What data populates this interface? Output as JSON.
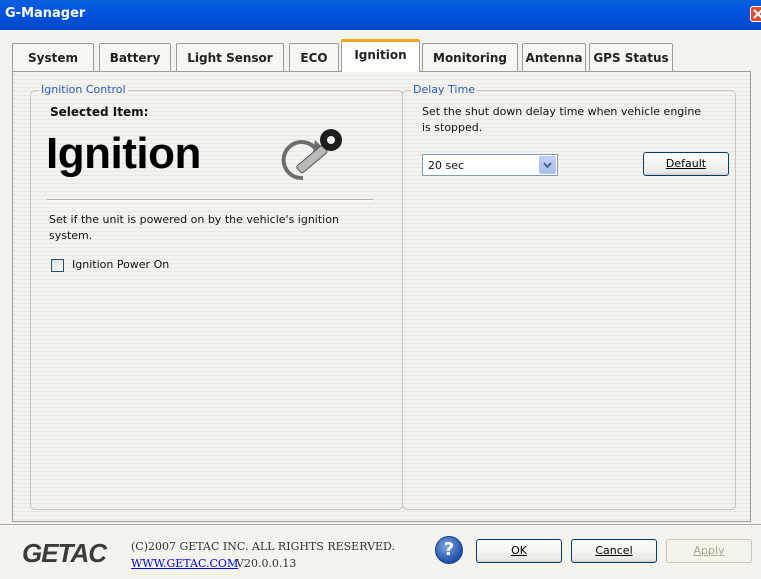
{
  "window": {
    "title": "G-Manager"
  },
  "tabs": [
    {
      "label": "System"
    },
    {
      "label": "Battery"
    },
    {
      "label": "Light Sensor"
    },
    {
      "label": "ECO"
    },
    {
      "label": "Ignition",
      "active": true
    },
    {
      "label": "Monitoring"
    },
    {
      "label": "Antenna"
    },
    {
      "label": "GPS Status"
    }
  ],
  "ignition_control": {
    "group_title": "Ignition Control",
    "selected_label": "Selected Item:",
    "selected_value": "Ignition",
    "description_line1": "Set if the unit is powered on by the vehicle's ignition",
    "description_line2": "system.",
    "checkbox_label": "Ignition Power On",
    "checkbox_checked": false,
    "icon": "key-icon"
  },
  "delay_time": {
    "group_title": "Delay Time",
    "description_line1": "Set the shut down delay time when vehicle engine",
    "description_line2": "is stopped.",
    "selected_option": "20 sec",
    "default_button_label": "Default"
  },
  "footer": {
    "logo": "GETAC",
    "copyright": "(C)2007 GETAC INC. ALL RIGHTS RESERVED.",
    "website": "WWW.GETAC.COM",
    "version": "V20.0.0.13",
    "help_label": "?",
    "ok_label": "OK",
    "cancel_label": "Cancel",
    "apply_label": "Apply"
  },
  "colors": {
    "title_bar": "#0053E0",
    "active_tab_accent": "#F5A623",
    "group_title": "#2C5BB8",
    "link": "#0000EE"
  }
}
